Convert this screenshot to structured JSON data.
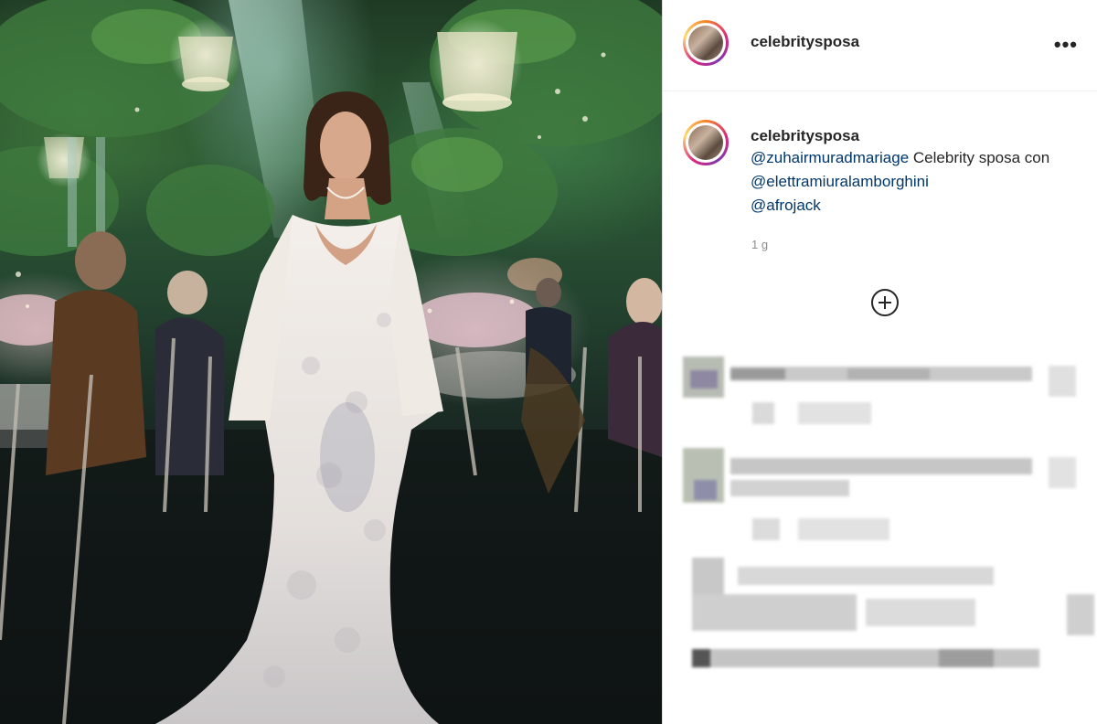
{
  "post": {
    "username": "celebritysposa",
    "more_label": "•••",
    "caption": {
      "author": "celebritysposa",
      "mention_1": "@zuhairmuradmariage",
      "text_1": " Celebrity sposa con ",
      "mention_2": "@elettramiuralamborghini",
      "mention_3": "@afrojack"
    },
    "time_ago": "1 g"
  },
  "icons": {
    "options": "more-options-icon",
    "load_more": "plus-circle-icon"
  },
  "colors": {
    "mention": "#00376b",
    "muted": "#8e8e8e",
    "text": "#262626",
    "divider": "#efefef"
  }
}
